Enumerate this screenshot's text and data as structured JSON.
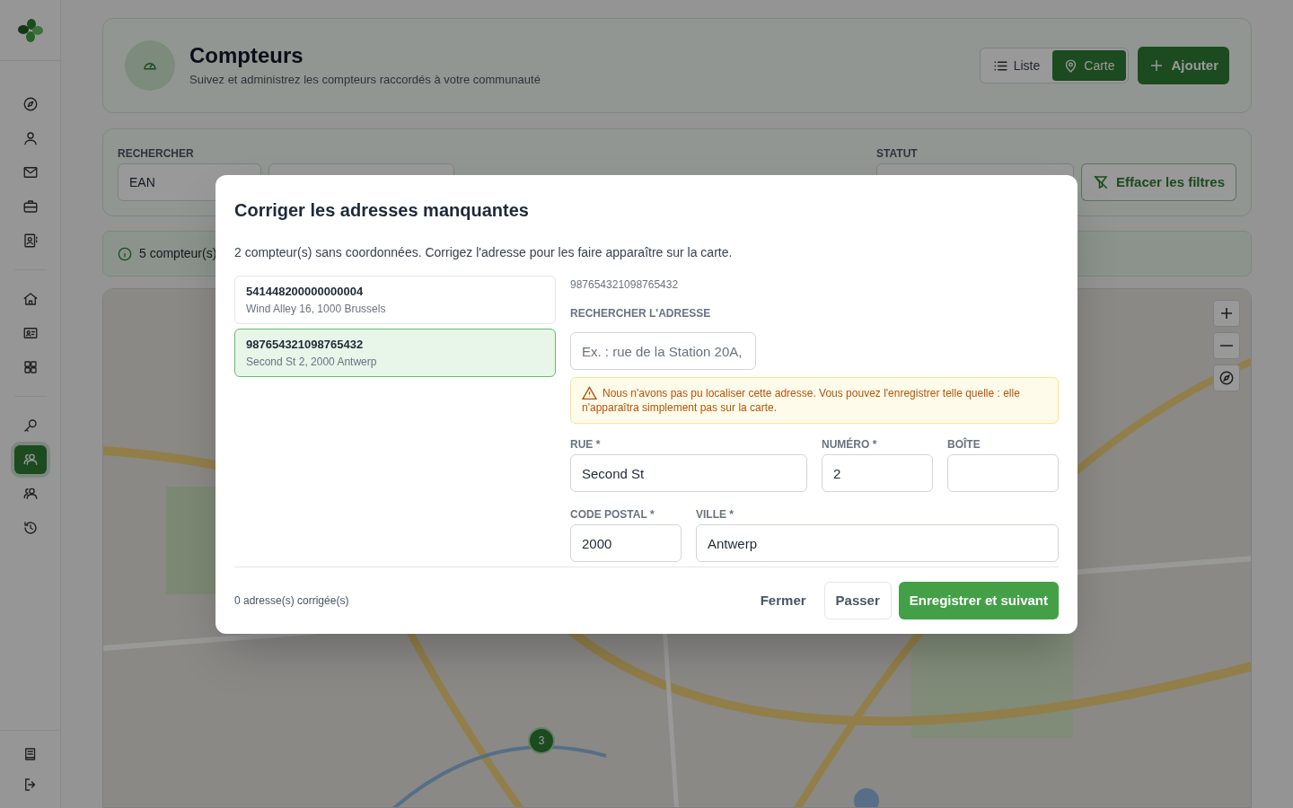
{
  "sidebar": {
    "groups": [
      [
        {
          "kind": "compass",
          "selected": false
        },
        {
          "kind": "user",
          "selected": false
        },
        {
          "kind": "mail",
          "selected": false
        },
        {
          "kind": "briefcase",
          "selected": false
        },
        {
          "kind": "contacts",
          "selected": false
        }
      ],
      [
        {
          "kind": "home",
          "selected": false
        },
        {
          "kind": "id-card",
          "selected": false
        },
        {
          "kind": "grid",
          "selected": false
        }
      ],
      [
        {
          "kind": "key",
          "selected": false
        },
        {
          "kind": "users",
          "selected": true
        },
        {
          "kind": "users",
          "selected": false
        },
        {
          "kind": "history",
          "selected": false
        }
      ]
    ],
    "bottom": [
      {
        "kind": "book",
        "selected": false
      },
      {
        "kind": "logout",
        "selected": false
      }
    ]
  },
  "header": {
    "title": "Compteurs",
    "subtitle": "Suivez et administrez les compteurs raccordés à votre communauté",
    "view_toggle": [
      {
        "label": "Liste",
        "kind": "list",
        "selected": false
      },
      {
        "label": "Carte",
        "kind": "pin",
        "selected": true
      }
    ],
    "add_button": "Ajouter"
  },
  "filters": {
    "search_label": "RECHERCHER",
    "search_type": "EAN",
    "status_label": "STATUT",
    "clear_button": "Effacer les filtres"
  },
  "info_bar": {
    "text": "5 compteur(s)"
  },
  "map": {
    "cluster": "3"
  },
  "dialog": {
    "title": "Corriger les adresses manquantes",
    "description": "2 compteur(s) sans coordonnées. Corrigez l'adresse pour les faire apparaître sur la carte.",
    "meters": [
      {
        "ean": "541448200000000004",
        "address": "Wind Alley 16, 1000 Brussels",
        "selected": false
      },
      {
        "ean": "987654321098765432",
        "address": "Second St 2, 2000 Antwerp",
        "selected": true
      }
    ],
    "current_ean": "987654321098765432",
    "search_label": "RECHERCHER L'ADRESSE",
    "search_placeholder": "Ex. : rue de la Station 20A,",
    "warning": "Nous n'avons pas pu localiser cette adresse. Vous pouvez l'enregistrer telle quelle : elle n'apparaîtra simplement pas sur la carte.",
    "fields": [
      [
        {
          "label": "RUE *",
          "value": "Second St"
        },
        {
          "label": "NUMÉRO *",
          "value": "2"
        },
        {
          "label": "BOÎTE"
        }
      ],
      [
        {
          "label": "CODE POSTAL *",
          "value": "2000"
        },
        {
          "label": "VILLE *",
          "value": "Antwerp"
        }
      ]
    ],
    "footer_text": "0 adresse(s) corrigée(s)",
    "close_button": "Fermer",
    "skip_button": "Passer",
    "save_button": "Enregistrer et suivant"
  }
}
